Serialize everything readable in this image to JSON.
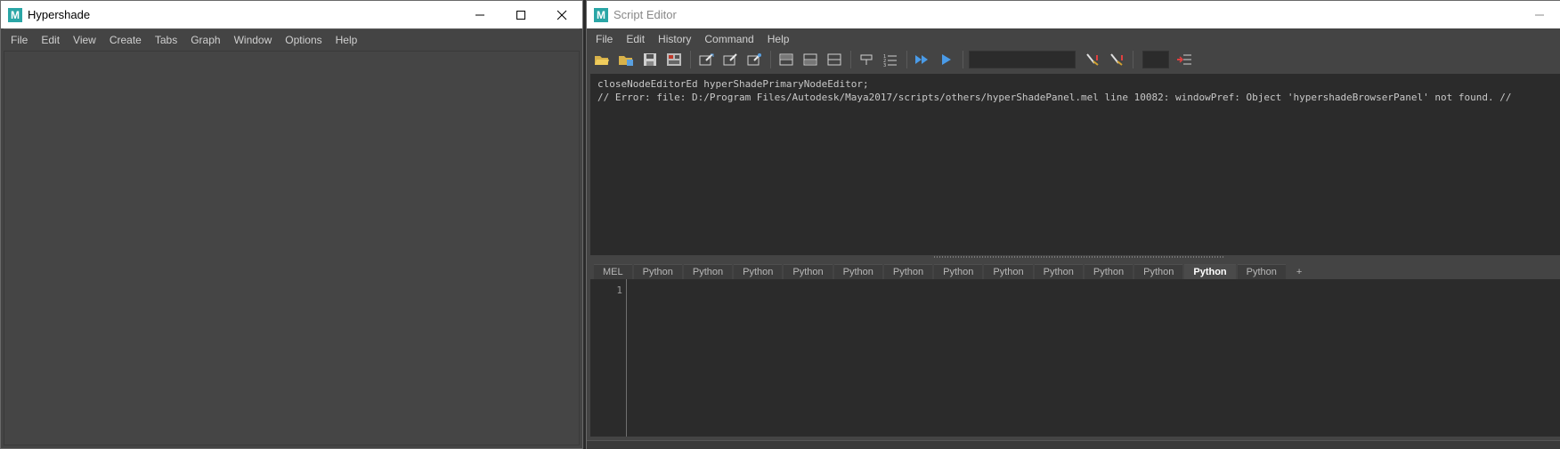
{
  "hypershade": {
    "title": "Hypershade",
    "icon": "maya-icon",
    "menu": [
      "File",
      "Edit",
      "View",
      "Create",
      "Tabs",
      "Graph",
      "Window",
      "Options",
      "Help"
    ]
  },
  "script_editor": {
    "title": "Script Editor",
    "icon": "maya-icon",
    "menu": [
      "File",
      "Edit",
      "History",
      "Command",
      "Help"
    ],
    "history_lines": [
      "closeNodeEditorEd hyperShadePrimaryNodeEditor;",
      "// Error: file: D:/Program Files/Autodesk/Maya2017/scripts/others/hyperShadePanel.mel line 10082: windowPref: Object 'hypershadeBrowserPanel' not found. //"
    ],
    "tabs": [
      "MEL",
      "Python",
      "Python",
      "Python",
      "Python",
      "Python",
      "Python",
      "Python",
      "Python",
      "Python",
      "Python",
      "Python",
      "Python",
      "Python",
      "+"
    ],
    "active_tab_index": 12,
    "line_number": "1"
  },
  "colors": {
    "maya_icon": "#2aa6a6",
    "panel_bg": "#444444",
    "editor_bg": "#2b2b2b"
  }
}
